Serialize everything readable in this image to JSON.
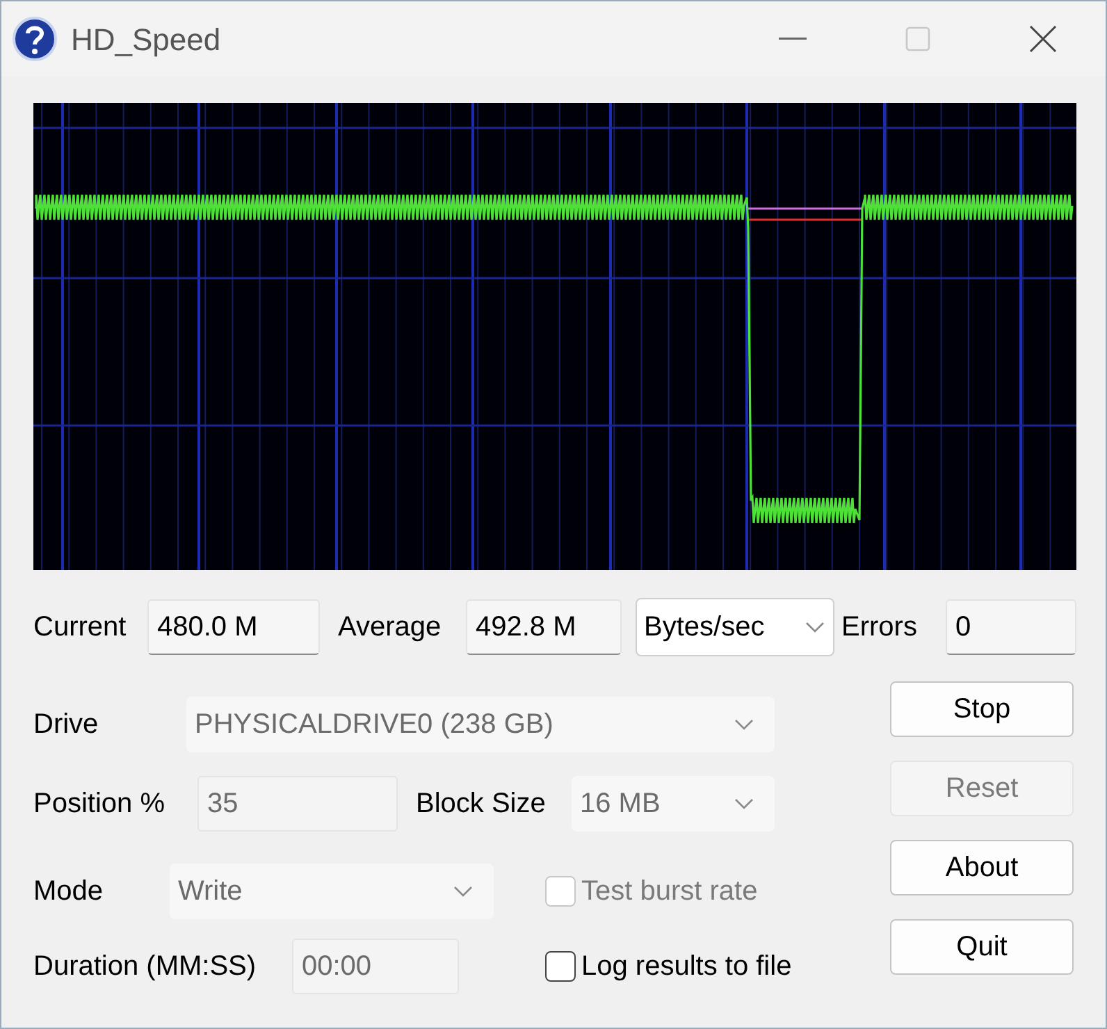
{
  "window": {
    "title": "HD_Speed"
  },
  "readouts": [
    {
      "label": "Current",
      "value": "480.0 M"
    },
    {
      "label": "Average",
      "value": "492.8 M"
    }
  ],
  "unit_select": {
    "value": "Bytes/sec"
  },
  "errors": {
    "label": "Errors",
    "value": "0"
  },
  "drive": {
    "label": "Drive",
    "value": "PHYSICALDRIVE0 (238 GB)",
    "disabled": true
  },
  "position": {
    "label": "Position %",
    "value": "35",
    "disabled": true
  },
  "block_size": {
    "label": "Block Size",
    "value": "16 MB",
    "disabled": true
  },
  "mode": {
    "label": "Mode",
    "value": "Write",
    "disabled": true
  },
  "duration": {
    "label": "Duration (MM:SS)",
    "value": "00:00",
    "disabled": true
  },
  "checkboxes": [
    {
      "label": "Test burst rate",
      "checked": false,
      "disabled": true
    },
    {
      "label": "Log results to file",
      "checked": false,
      "disabled": false
    }
  ],
  "buttons": [
    {
      "label": "Stop",
      "disabled": false
    },
    {
      "label": "Reset",
      "disabled": true
    },
    {
      "label": "About",
      "disabled": false
    },
    {
      "label": "Quit",
      "disabled": false
    }
  ]
}
